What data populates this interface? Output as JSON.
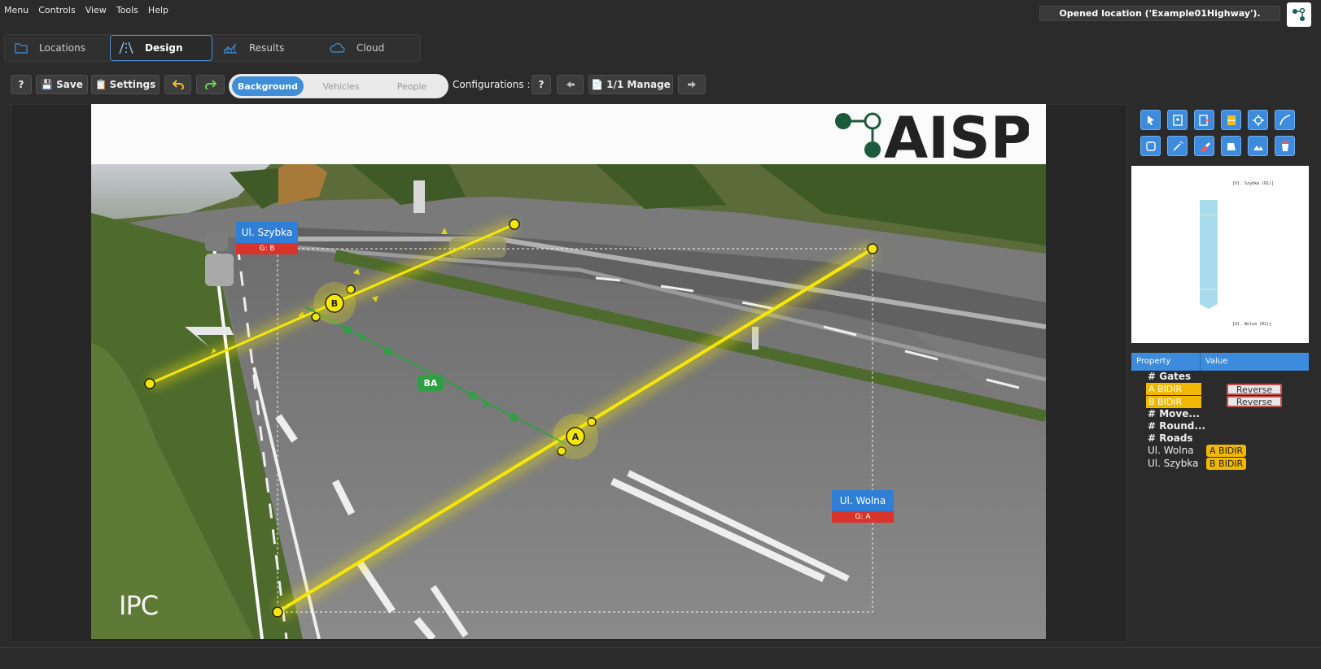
{
  "menu": [
    "Menu",
    "Controls",
    "View",
    "Tools",
    "Help"
  ],
  "status": "Opened location ('Example01Highway').",
  "main_tabs": [
    {
      "label": "Locations",
      "icon": "folder-icon"
    },
    {
      "label": "Design",
      "icon": "road-icon",
      "active": true
    },
    {
      "label": "Results",
      "icon": "chart-icon"
    },
    {
      "label": "Cloud",
      "icon": "cloud-icon"
    }
  ],
  "toolbar": {
    "help": "?",
    "save": "Save",
    "settings": "Settings",
    "segments": [
      {
        "label": "Background",
        "active": true
      },
      {
        "label": "Vehicles"
      },
      {
        "label": "People"
      }
    ],
    "configurations_label": "Configurations :",
    "config_help": "?",
    "manage": "1/1 Manage"
  },
  "canvas": {
    "logo_text": "AISP",
    "watermark": "IPC",
    "roads": [
      {
        "name": "Ul. Szybka",
        "gate": "G: B"
      },
      {
        "name": "Ul. Wolna",
        "gate": "G: A"
      }
    ],
    "gates": [
      "A",
      "B"
    ],
    "movement": "BA"
  },
  "minimap": {
    "top_label": "[Ul. Szybka (R1)]",
    "bottom_label": "[Ul. Wolna (R2)]"
  },
  "properties": {
    "headers": [
      "Property",
      "Value"
    ],
    "gates_title": "# Gates",
    "gates": [
      {
        "name": "A BIDIR",
        "action": "Reverse"
      },
      {
        "name": "B BIDIR",
        "action": "Reverse"
      }
    ],
    "movements_title": "# Move...",
    "roundabouts_title": "# Round...",
    "roads_title": "# Roads",
    "roads": [
      {
        "name": "Ul. Wolna",
        "value": "A BIDIR"
      },
      {
        "name": "Ul. Szybka",
        "value": "B BIDIR"
      }
    ]
  },
  "colors": {
    "accent": "#3f8fd8",
    "gate": "#f5e60a",
    "movement": "#2ea043",
    "road_label": "#2f7fd6",
    "gate_badge": "#d9342b",
    "highlight": "#f0b800"
  }
}
